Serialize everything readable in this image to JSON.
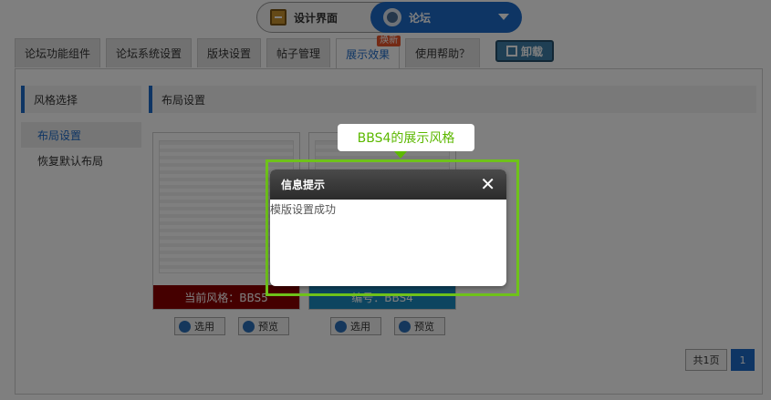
{
  "header": {
    "mode_design_label": "设计界面",
    "mode_forum_label": "论坛"
  },
  "tabs": [
    {
      "label": "论坛功能组件"
    },
    {
      "label": "论坛系统设置"
    },
    {
      "label": "版块设置"
    },
    {
      "label": "帖子管理"
    },
    {
      "label": "展示效果",
      "badge": "焕新"
    },
    {
      "label": "使用帮助？"
    }
  ],
  "uninstall_label": "卸载",
  "sidebar": {
    "title": "风格选择",
    "items": [
      {
        "label": "布局设置"
      },
      {
        "label": "恢复默认布局"
      }
    ]
  },
  "main": {
    "title": "布局设置"
  },
  "cards": [
    {
      "label": "当前风格：BBS5",
      "color": "#8b0000"
    },
    {
      "label": "编号：BBS4",
      "color": "#1b8bc0"
    }
  ],
  "card_buttons": {
    "use": "选用",
    "preview": "预览"
  },
  "pager": {
    "total": "共1页",
    "current": "1"
  },
  "tooltip": "BBS4的展示风格",
  "dialog": {
    "title": "信息提示",
    "message": "模版设置成功"
  }
}
